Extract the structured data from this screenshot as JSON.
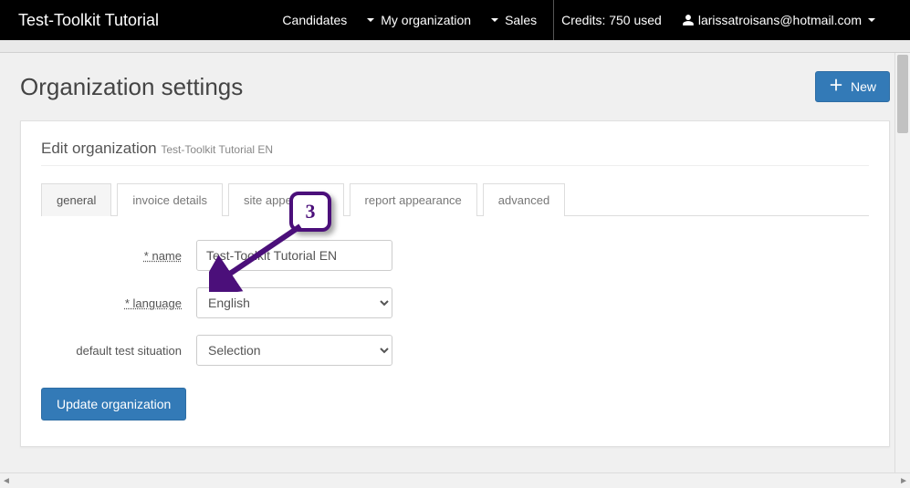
{
  "nav": {
    "brand": "Test-Toolkit Tutorial",
    "links": {
      "candidates": "Candidates",
      "my_org": "My organization",
      "sales": "Sales"
    },
    "credits": "Credits: 750 used",
    "user_email": "larissatroisans@hotmail.com"
  },
  "page": {
    "title": "Organization settings",
    "new_btn": "New"
  },
  "panel": {
    "heading": "Edit organization",
    "subheading": "Test-Toolkit Tutorial EN"
  },
  "tabs": {
    "general": "general",
    "invoice": "invoice details",
    "site": "site appearance",
    "report": "report appearance",
    "advanced": "advanced"
  },
  "form": {
    "name_label": "* name",
    "name_value": "Test-Toolkit Tutorial EN",
    "language_label": "* language",
    "language_value": "English",
    "default_test_label": "default test situation",
    "default_test_value": "Selection",
    "update_btn": "Update organization"
  },
  "callout": {
    "number": "3"
  }
}
